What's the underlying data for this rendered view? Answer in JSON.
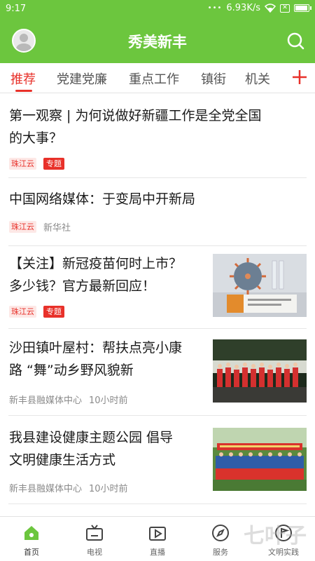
{
  "status_bar": {
    "time": "9:17",
    "network_speed": "6.93K/s",
    "signal_dots": "•••",
    "sim_indicator": "✕"
  },
  "header": {
    "title": "秀美新丰",
    "avatar_icon": "user-avatar",
    "search_icon": "search-icon",
    "color": "#6cc63e"
  },
  "tabs": [
    {
      "label": "推荐",
      "active": true
    },
    {
      "label": "党建党廉",
      "active": false
    },
    {
      "label": "重点工作",
      "active": false
    },
    {
      "label": "镇街",
      "active": false
    },
    {
      "label": "机关",
      "active": false
    }
  ],
  "tab_add_icon": "plus-icon",
  "accent_color": "#e8312a",
  "feed": [
    {
      "title_line1": "第一观察 | 为何说做好新疆工作是全党全国",
      "title_line2": "的大事？",
      "source": "珠江云",
      "tag": "专题"
    },
    {
      "title_line1": "中国网络媒体：于变局中开新局",
      "source": "珠江云",
      "publisher": "新华社"
    },
    {
      "title_line1": "【关注】新冠疫苗何时上市？",
      "title_line2": "多少钱？官方最新回应！",
      "source": "珠江云",
      "tag": "专题",
      "image": "vaccine-photo"
    },
    {
      "title_line1": "沙田镇叶屋村：帮扶点亮小康",
      "title_line2": "路 “舞”动乡野风貌新",
      "publisher": "新丰县融媒体中心",
      "time": "10小时前",
      "image": "dance-group-photo"
    },
    {
      "title_line1": "我县建设健康主题公园 倡导",
      "title_line2": "文明健康生活方式",
      "publisher": "新丰县融媒体中心",
      "time": "10小时前",
      "image": "group-banner-photo"
    }
  ],
  "bottom_nav": [
    {
      "label": "首页",
      "icon": "home-icon",
      "active": true
    },
    {
      "label": "电视",
      "icon": "tv-icon",
      "active": false
    },
    {
      "label": "直播",
      "icon": "live-icon",
      "active": false
    },
    {
      "label": "服务",
      "icon": "compass-icon",
      "active": false
    },
    {
      "label": "文明实践",
      "icon": "flag-circle-icon",
      "active": false
    }
  ],
  "watermark": "七叶子"
}
